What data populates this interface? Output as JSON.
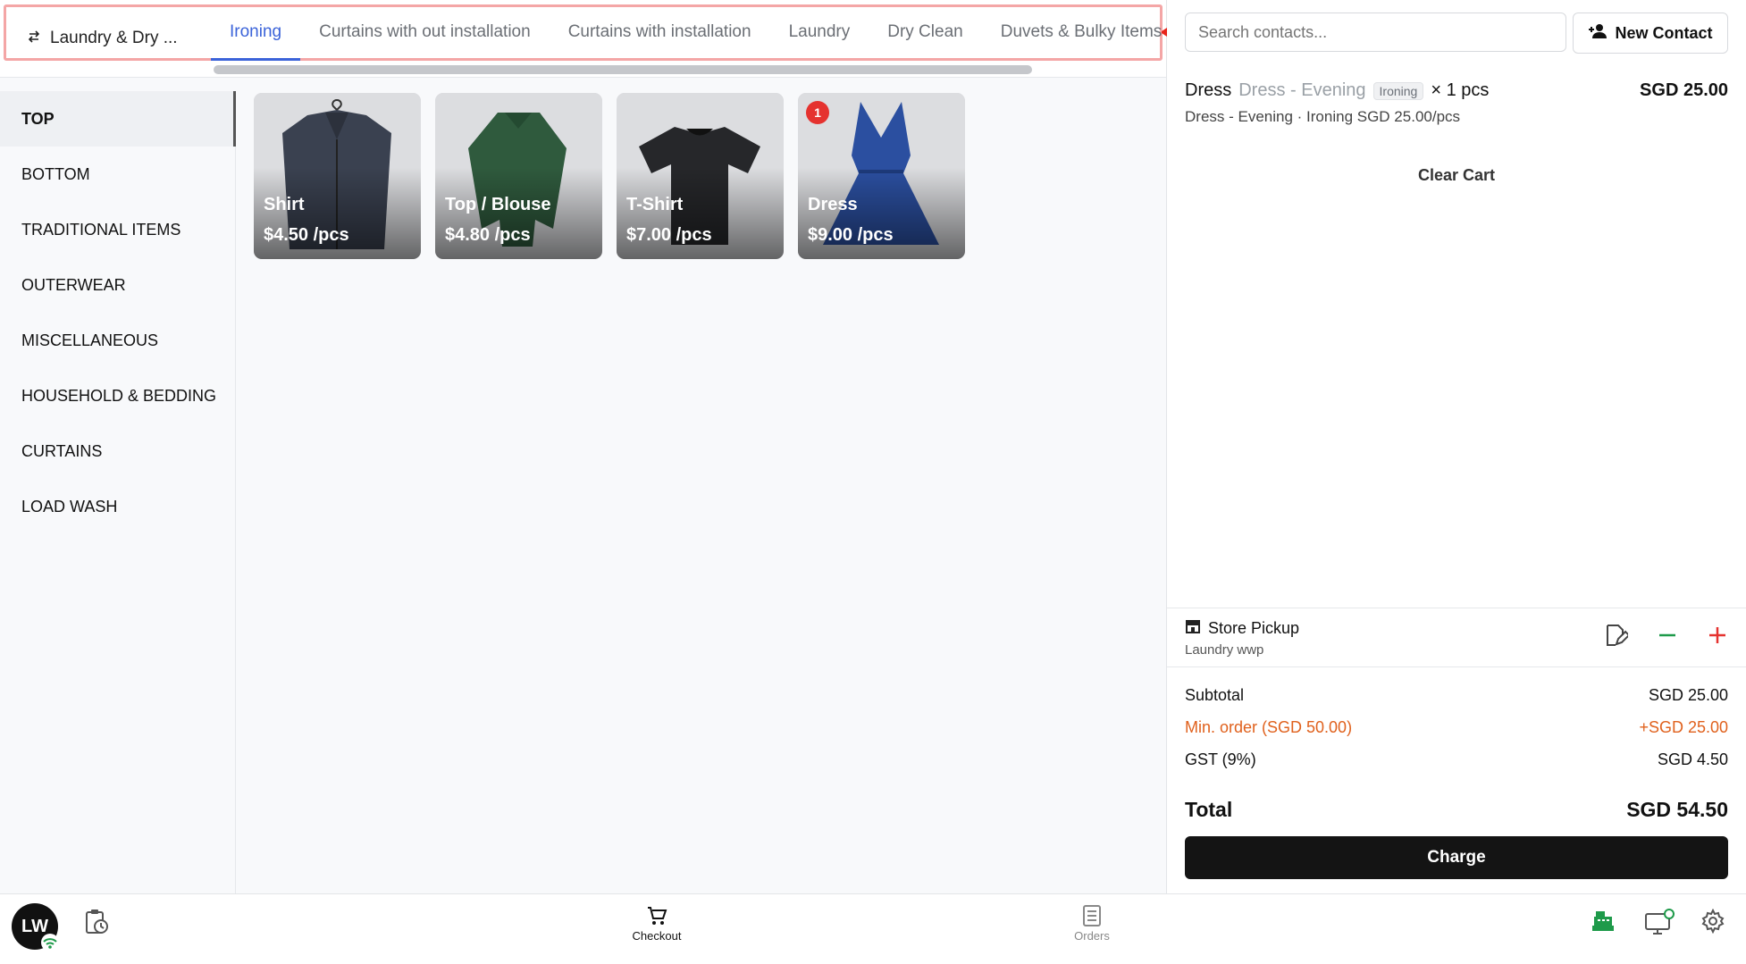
{
  "store_switcher": {
    "label": "Laundry & Dry ..."
  },
  "tabs": [
    {
      "label": "Ironing",
      "active": true
    },
    {
      "label": "Curtains with out installation"
    },
    {
      "label": "Curtains with installation"
    },
    {
      "label": "Laundry"
    },
    {
      "label": "Dry Clean"
    },
    {
      "label": "Duvets & Bulky Items"
    }
  ],
  "categories": [
    {
      "label": "TOP",
      "active": true
    },
    {
      "label": "BOTTOM"
    },
    {
      "label": "TRADITIONAL ITEMS"
    },
    {
      "label": "OUTERWEAR"
    },
    {
      "label": "MISCELLANEOUS"
    },
    {
      "label": "HOUSEHOLD & BEDDING"
    },
    {
      "label": "CURTAINS"
    },
    {
      "label": "LOAD WASH"
    }
  ],
  "products": [
    {
      "name": "Shirt",
      "price": "$4.50 /pcs",
      "color": "#3a4150"
    },
    {
      "name": "Top / Blouse",
      "price": "$4.80 /pcs",
      "color": "#2f5a3d"
    },
    {
      "name": "T-Shirt",
      "price": "$7.00 /pcs",
      "color": "#26272a"
    },
    {
      "name": "Dress",
      "price": "$9.00 /pcs",
      "color": "#2b4fa0",
      "badge": "1"
    }
  ],
  "search": {
    "placeholder": "Search contacts..."
  },
  "new_contact_label": "New Contact",
  "cart": {
    "item": {
      "name": "Dress",
      "variant": "Dress - Evening",
      "service": "Ironing",
      "qty": "× 1 pcs",
      "price": "SGD 25.00",
      "detail": "Dress - Evening · Ironing SGD 25.00/pcs"
    },
    "clear_label": "Clear Cart"
  },
  "pickup": {
    "title": "Store Pickup",
    "subtitle": "Laundry wwp"
  },
  "summary": {
    "subtotal_label": "Subtotal",
    "subtotal": "SGD 25.00",
    "min_label": "Min. order (SGD 50.00)",
    "min_value": "+SGD 25.00",
    "gst_label": "GST (9%)",
    "gst": "SGD 4.50",
    "total_label": "Total",
    "total": "SGD 54.50"
  },
  "charge_label": "Charge",
  "bottom_nav": {
    "avatar": "LW",
    "checkout": "Checkout",
    "orders": "Orders"
  },
  "colors": {
    "accent": "#3b63d9",
    "warning": "#e0611d",
    "danger": "#e5322f",
    "success": "#1e9a4a"
  }
}
